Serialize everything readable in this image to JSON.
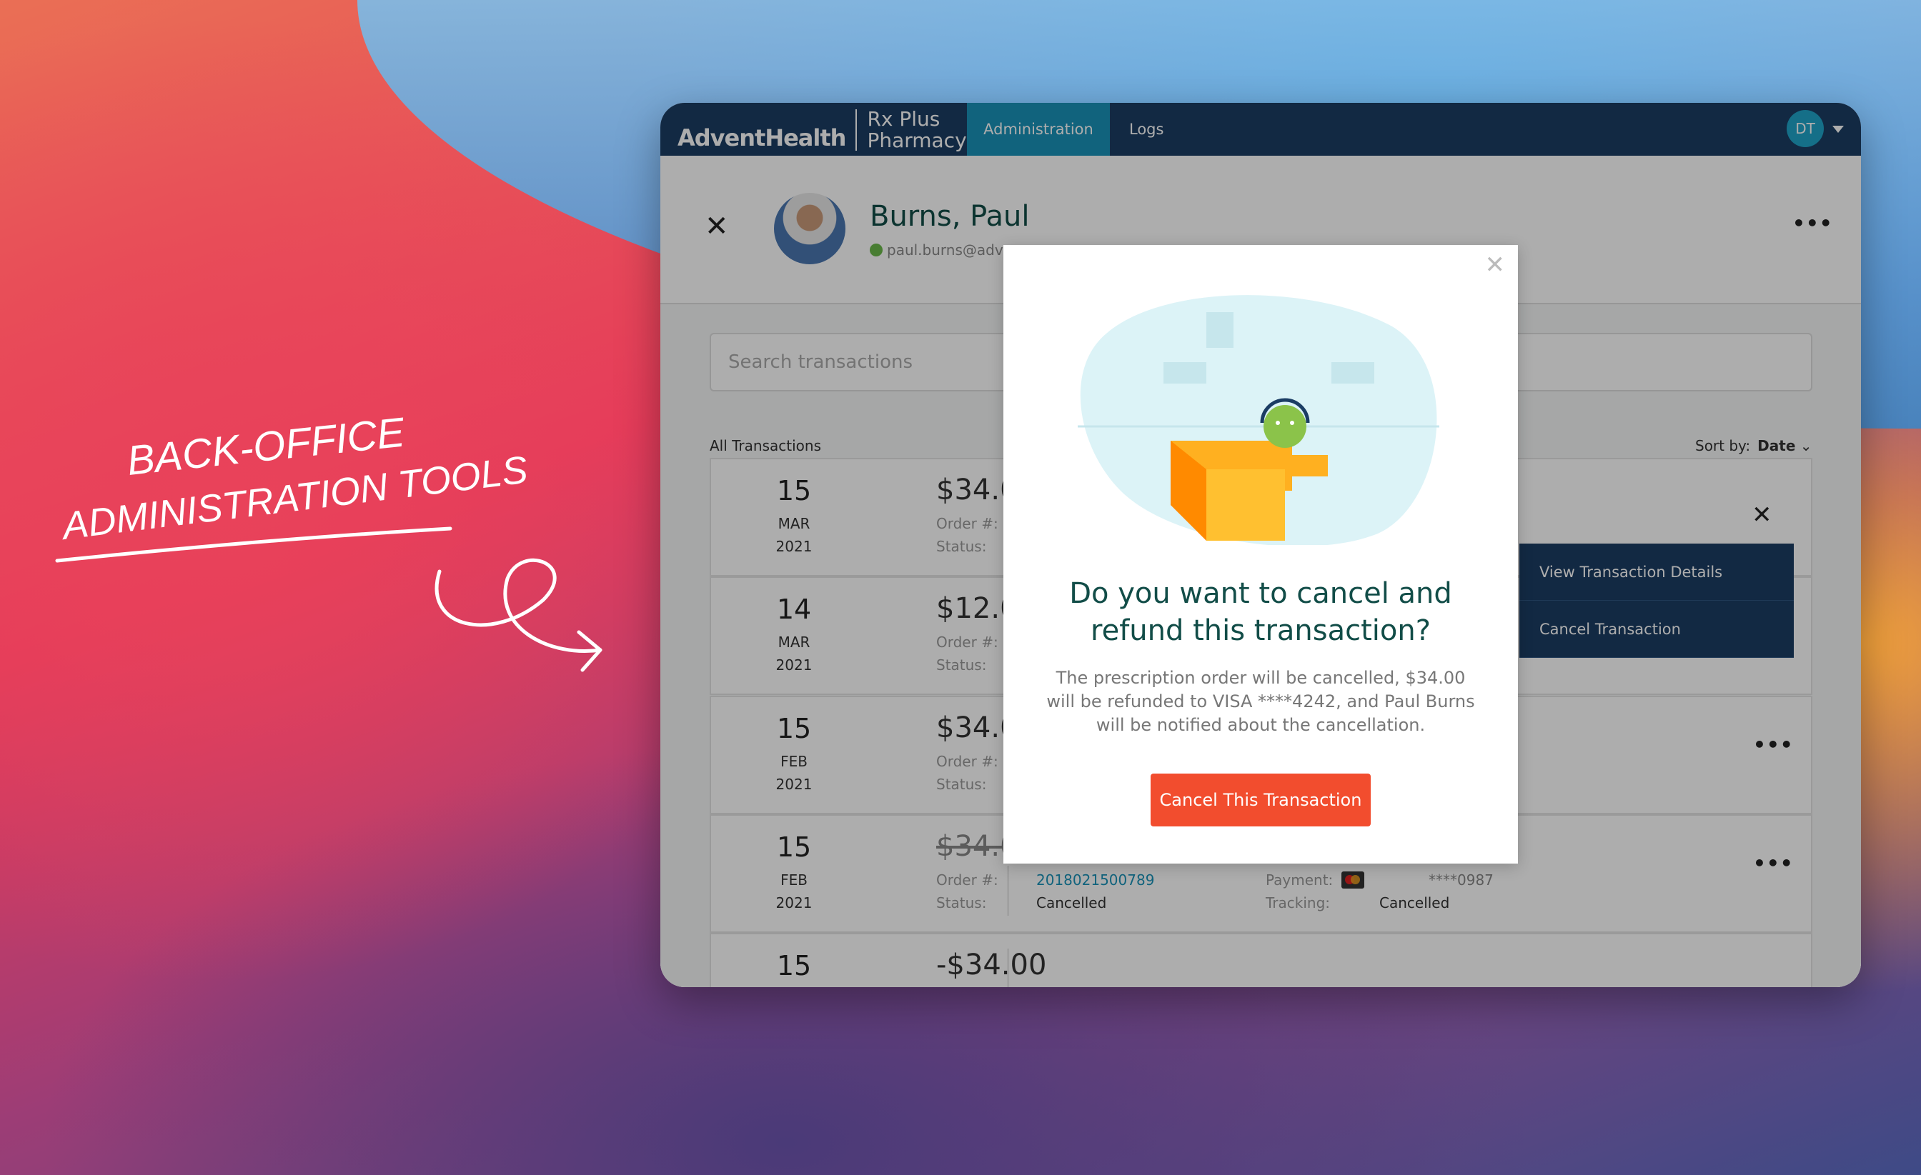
{
  "marketing": {
    "headline_line1": "BACK-OFFICE",
    "headline_line2": "ADMINISTRATION TOOLS"
  },
  "nav": {
    "brand": "AdventHealth",
    "product_line1": "Rx Plus",
    "product_line2": "Pharmacy",
    "tabs": [
      {
        "label": "Administration",
        "active": true
      },
      {
        "label": "Logs",
        "active": false
      }
    ],
    "user_initials": "DT"
  },
  "profile": {
    "name": "Burns, Paul",
    "email": "paul.burns@adv",
    "status_color": "#6bb84a"
  },
  "search": {
    "placeholder": "Search transactions"
  },
  "list": {
    "title": "All Transactions",
    "sort_label": "Sort by:",
    "sort_value": "Date"
  },
  "labels": {
    "order": "Order #:",
    "status": "Status:",
    "payment": "Payment:",
    "tracking": "Tracking:"
  },
  "transactions": [
    {
      "day": "15",
      "month": "MAR",
      "year": "2021",
      "amount": "$34.00"
    },
    {
      "day": "14",
      "month": "MAR",
      "year": "2021",
      "amount": "$12.00"
    },
    {
      "day": "15",
      "month": "FEB",
      "year": "2021",
      "amount": "$34.00"
    },
    {
      "day": "15",
      "month": "FEB",
      "year": "2021",
      "amount": "$34.00",
      "cancelled": true,
      "order": "2018021500789",
      "status": "Cancelled",
      "card": "****0987",
      "tracking": "Cancelled"
    },
    {
      "day": "15",
      "amount": "-$34.00"
    }
  ],
  "row_menu": {
    "items": [
      "View Transaction Details",
      "Cancel Transaction"
    ]
  },
  "modal": {
    "title": "Do you want to cancel and refund this transaction?",
    "body": "The prescription order will be cancelled, $34.00 will be refunded to VISA ****4242, and Paul Burns will be notified about the cancellation.",
    "confirm": "Cancel This Transaction",
    "accent": "#f24d2e"
  }
}
